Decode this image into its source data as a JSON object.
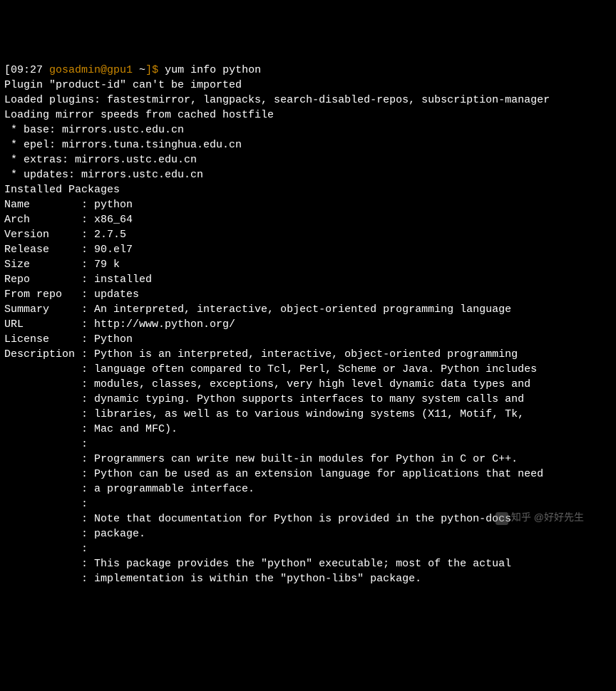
{
  "prompt": {
    "time": "[09:27",
    "user": " gosadmin@gpu1",
    "path": " ~",
    "end": "]$",
    "command": " yum info python"
  },
  "lines": [
    "Plugin \"product-id\" can't be imported",
    "Loaded plugins: fastestmirror, langpacks, search-disabled-repos, subscription-manager",
    "Loading mirror speeds from cached hostfile",
    " * base: mirrors.ustc.edu.cn",
    " * epel: mirrors.tuna.tsinghua.edu.cn",
    " * extras: mirrors.ustc.edu.cn",
    " * updates: mirrors.ustc.edu.cn",
    "Installed Packages",
    "Name        : python",
    "Arch        : x86_64",
    "Version     : 2.7.5",
    "Release     : 90.el7",
    "Size        : 79 k",
    "Repo        : installed",
    "From repo   : updates",
    "Summary     : An interpreted, interactive, object-oriented programming language",
    "URL         : http://www.python.org/",
    "License     : Python",
    "Description : Python is an interpreted, interactive, object-oriented programming",
    "            : language often compared to Tcl, Perl, Scheme or Java. Python includes",
    "            : modules, classes, exceptions, very high level dynamic data types and",
    "            : dynamic typing. Python supports interfaces to many system calls and",
    "            : libraries, as well as to various windowing systems (X11, Motif, Tk,",
    "            : Mac and MFC).",
    "            : ",
    "            : Programmers can write new built-in modules for Python in C or C++.",
    "            : Python can be used as an extension language for applications that need",
    "            : a programmable interface.",
    "            : ",
    "            : Note that documentation for Python is provided in the python-docs",
    "            : package.",
    "            : ",
    "            : This package provides the \"python\" executable; most of the actual",
    "            : implementation is within the \"python-libs\" package."
  ],
  "watermark": "知乎 @好好先生"
}
